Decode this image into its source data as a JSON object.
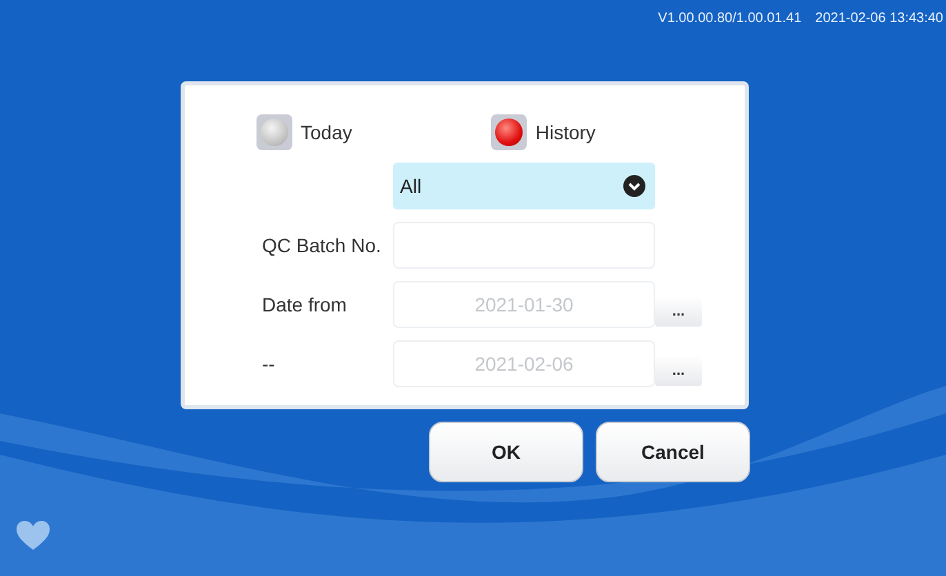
{
  "status_bar": {
    "version": "V1.00.00.80/1.00.01.41",
    "datetime": "2021-02-06 13:43:40"
  },
  "dialog": {
    "modes": [
      {
        "label": "Today",
        "selected": false
      },
      {
        "label": "History",
        "selected": true
      }
    ],
    "dropdown": {
      "value": "All"
    },
    "fields": [
      {
        "label": "QC Batch No."
      },
      {
        "label": "Date from",
        "placeholder": "2021-01-30",
        "picker_label": "..."
      },
      {
        "label": "--",
        "placeholder": "2021-02-06",
        "picker_label": "..."
      }
    ]
  },
  "buttons": [
    "OK",
    "Cancel"
  ]
}
